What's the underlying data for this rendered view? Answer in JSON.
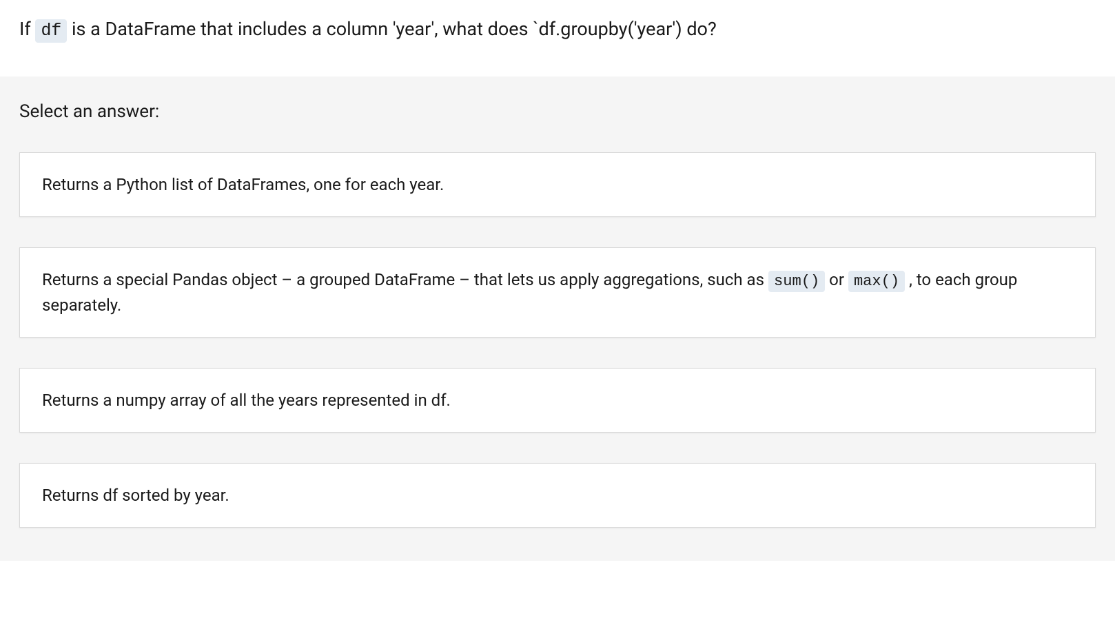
{
  "question": {
    "prefix": "If ",
    "code1": "df",
    "middle": " is a DataFrame that includes a column 'year', what does `df.groupby('year') do?"
  },
  "answers_heading": "Select an answer:",
  "answers": [
    {
      "segments": [
        {
          "type": "text",
          "value": "Returns a Python list of DataFrames, one for each year."
        }
      ]
    },
    {
      "segments": [
        {
          "type": "text",
          "value": "Returns a special Pandas object – a grouped DataFrame – that lets us apply aggregations, such as "
        },
        {
          "type": "code",
          "value": "sum()"
        },
        {
          "type": "text",
          "value": " or "
        },
        {
          "type": "code",
          "value": "max()"
        },
        {
          "type": "text",
          "value": " , to each group separately."
        }
      ]
    },
    {
      "segments": [
        {
          "type": "text",
          "value": "Returns a numpy array of all the years represented in df."
        }
      ]
    },
    {
      "segments": [
        {
          "type": "text",
          "value": "Returns df sorted by year."
        }
      ]
    }
  ]
}
